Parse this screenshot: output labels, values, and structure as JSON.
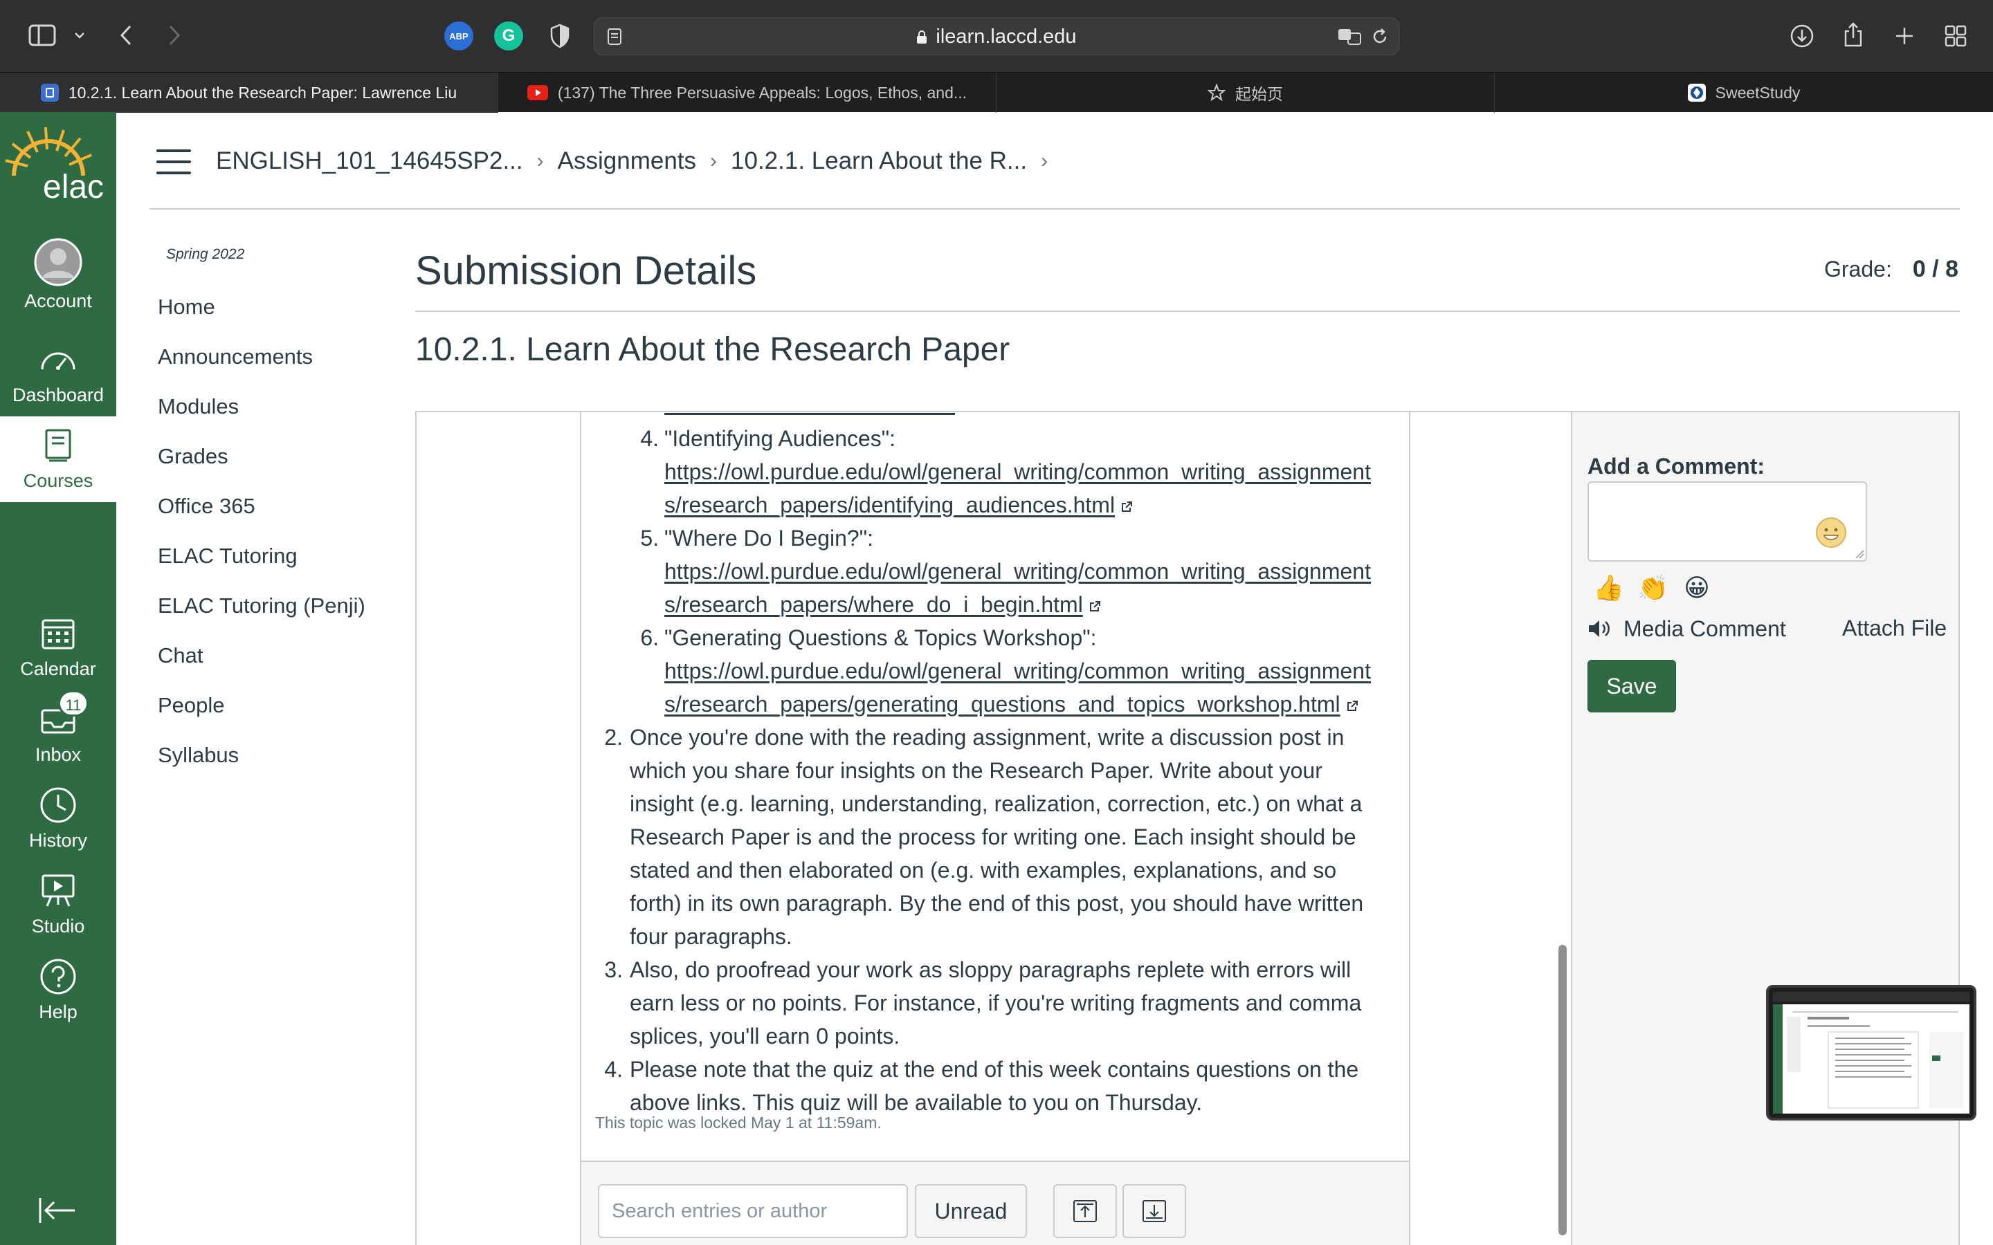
{
  "browser": {
    "url": "ilearn.laccd.edu",
    "tabs": [
      {
        "title": "10.2.1. Learn About the Research Paper: Lawrence Liu",
        "favicon": "canvas-icon",
        "active": true
      },
      {
        "title": "(137) The Three Persuasive Appeals: Logos, Ethos, and...",
        "favicon": "youtube-icon",
        "active": false
      },
      {
        "title": "起始页",
        "favicon": "star-icon",
        "active": false
      },
      {
        "title": "SweetStudy",
        "favicon": "sweetstudy-icon",
        "active": false
      }
    ],
    "extensions": [
      {
        "name": "adblock-plus-icon",
        "label": "ABP",
        "color": "#2b6fd6"
      },
      {
        "name": "grammarly-icon",
        "label": "G",
        "color": "#15c39a"
      }
    ]
  },
  "global_nav": {
    "logo": "elac",
    "items": [
      {
        "label": "Account",
        "icon": "account-avatar-icon"
      },
      {
        "label": "Dashboard",
        "icon": "dashboard-icon"
      },
      {
        "label": "Courses",
        "icon": "courses-icon",
        "active": true
      },
      {
        "label": "Calendar",
        "icon": "calendar-icon"
      },
      {
        "label": "Inbox",
        "icon": "inbox-icon",
        "badge": "11"
      },
      {
        "label": "History",
        "icon": "history-icon"
      },
      {
        "label": "Studio",
        "icon": "studio-icon"
      },
      {
        "label": "Help",
        "icon": "help-icon"
      }
    ]
  },
  "breadcrumbs": [
    "ENGLISH_101_14645SP2...",
    "Assignments",
    "10.2.1. Learn About the R..."
  ],
  "course_nav": {
    "term": "Spring 2022",
    "links": [
      "Home",
      "Announcements",
      "Modules",
      "Grades",
      "Office 365",
      "ELAC Tutoring",
      "ELAC Tutoring (Penji)",
      "Chat",
      "People",
      "Syllabus"
    ]
  },
  "page": {
    "title": "Submission Details",
    "grade_label": "Grade:",
    "grade_value": "0 / 8",
    "assignment_title": "10.2.1. Learn About the Research Paper"
  },
  "discussion": {
    "sub_items": [
      {
        "num": "4.",
        "title": "\"Identifying Audiences\":",
        "url_line1": "https://owl.purdue.edu/owl/general_writing/common_writing_assignment",
        "url_line2": "s/research_papers/identifying_audiences.html"
      },
      {
        "num": "5.",
        "title": "\"Where Do I Begin?\":",
        "url_line1": "https://owl.purdue.edu/owl/general_writing/common_writing_assignment",
        "url_line2": "s/research_papers/where_do_i_begin.html"
      },
      {
        "num": "6.",
        "title": "\"Generating Questions & Topics Workshop\":",
        "url_line1": "https://owl.purdue.edu/owl/general_writing/common_writing_assignment",
        "url_line2": "s/research_papers/generating_questions_and_topics_workshop.html"
      }
    ],
    "items": [
      {
        "num": "2.",
        "lines": [
          "Once you're done with the reading assignment, write a discussion post in",
          "which you share four insights on the Research Paper. Write about your",
          "insight (e.g. learning, understanding, realization, correction, etc.) on what a",
          "Research Paper is and the process for writing one. Each insight should be",
          "stated and then elaborated on (e.g. with examples, explanations, and so",
          "forth) in its own paragraph. By the end of this post, you should have written",
          "four paragraphs."
        ]
      },
      {
        "num": "3.",
        "lines": [
          "Also, do proofread your work as sloppy paragraphs replete with errors will",
          "earn less or no points. For instance, if you're writing fragments and comma",
          "splices, you'll earn 0 points."
        ]
      },
      {
        "num": "4.",
        "lines": [
          "Please note that the quiz at the end of this week contains questions on the",
          "above links. This quiz will be available to you on Thursday."
        ]
      }
    ],
    "locked_note": "This topic was locked May 1 at 11:59am.",
    "search_placeholder": "Search entries or author",
    "unread_label": "Unread"
  },
  "comments": {
    "label": "Add a Comment:",
    "quick_emojis": [
      "👍",
      "👏",
      "😀"
    ],
    "media_comment": "Media Comment",
    "attach_file": "Attach File",
    "save": "Save"
  },
  "colors": {
    "canvas_green": "#2e6b43",
    "text": "#2d3b45",
    "border": "#c7cdd1",
    "browser_chrome": "#2f2f31"
  }
}
